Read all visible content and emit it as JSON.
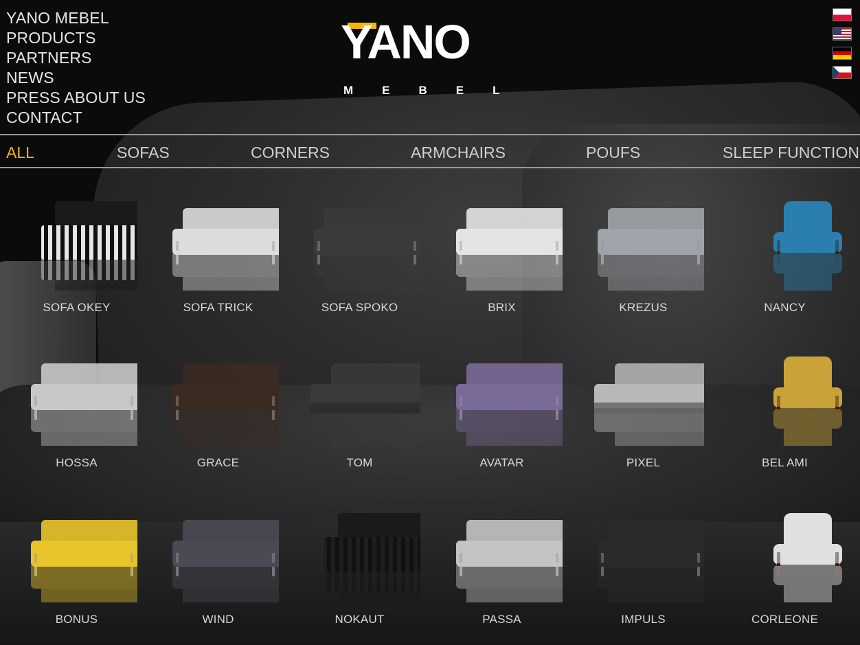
{
  "nav": {
    "items": [
      "YANO MEBEL",
      "PRODUCTS",
      "PARTNERS",
      "NEWS",
      "PRESS ABOUT US",
      "CONTACT"
    ]
  },
  "logo": {
    "wordmark": "YANO",
    "subtitle": "MEBEL"
  },
  "languages": [
    "pl-flag",
    "us-flag",
    "de-flag",
    "cz-flag"
  ],
  "categories": {
    "all": "ALL",
    "sofas": "SOFAS",
    "corners": "CORNERS",
    "armchairs": "ARMCHAIRS",
    "poufs": "POUFS",
    "sleep": "SLEEP FUNCTION",
    "active": "ALL"
  },
  "colors": {
    "accent": "#f2b705",
    "text": "#d8d8d8",
    "background": "#0b0b0b"
  },
  "products": [
    {
      "name": "SOFA OKEY",
      "color": "#e6e6e6",
      "style": "striped"
    },
    {
      "name": "SOFA TRICK",
      "color": "#dcdcdc",
      "style": "sofa"
    },
    {
      "name": "SOFA SPOKO",
      "color": "#3a3a3a",
      "style": "sofa"
    },
    {
      "name": "BRIX",
      "color": "#e4e4e4",
      "style": "sofa"
    },
    {
      "name": "KREZUS",
      "color": "#a0a4aa",
      "style": "sofa"
    },
    {
      "name": "NANCY",
      "color": "#2a7fb0",
      "style": "armchair"
    },
    {
      "name": "HOSSA",
      "color": "#c8c8c8",
      "style": "sofa"
    },
    {
      "name": "GRACE",
      "color": "#3b2a22",
      "style": "sofa"
    },
    {
      "name": "TOM",
      "color": "#3a3a3a",
      "style": "corner"
    },
    {
      "name": "AVATAR",
      "color": "#7a6a98",
      "style": "sofa"
    },
    {
      "name": "PIXEL",
      "color": "#b8b8b8",
      "style": "corner"
    },
    {
      "name": "BEL AMI",
      "color": "#c9a33a",
      "style": "armchair"
    },
    {
      "name": "BONUS",
      "color": "#e8c52a",
      "style": "sofa"
    },
    {
      "name": "WIND",
      "color": "#4a4a55",
      "style": "sofa"
    },
    {
      "name": "NOKAUT",
      "color": "#1e1e1e",
      "style": "striped"
    },
    {
      "name": "PASSA",
      "color": "#c4c4c4",
      "style": "sofa"
    },
    {
      "name": "IMPULS",
      "color": "#2a2a2a",
      "style": "sofa"
    },
    {
      "name": "CORLEONE",
      "color": "#e0e0e0",
      "style": "armchair"
    }
  ]
}
